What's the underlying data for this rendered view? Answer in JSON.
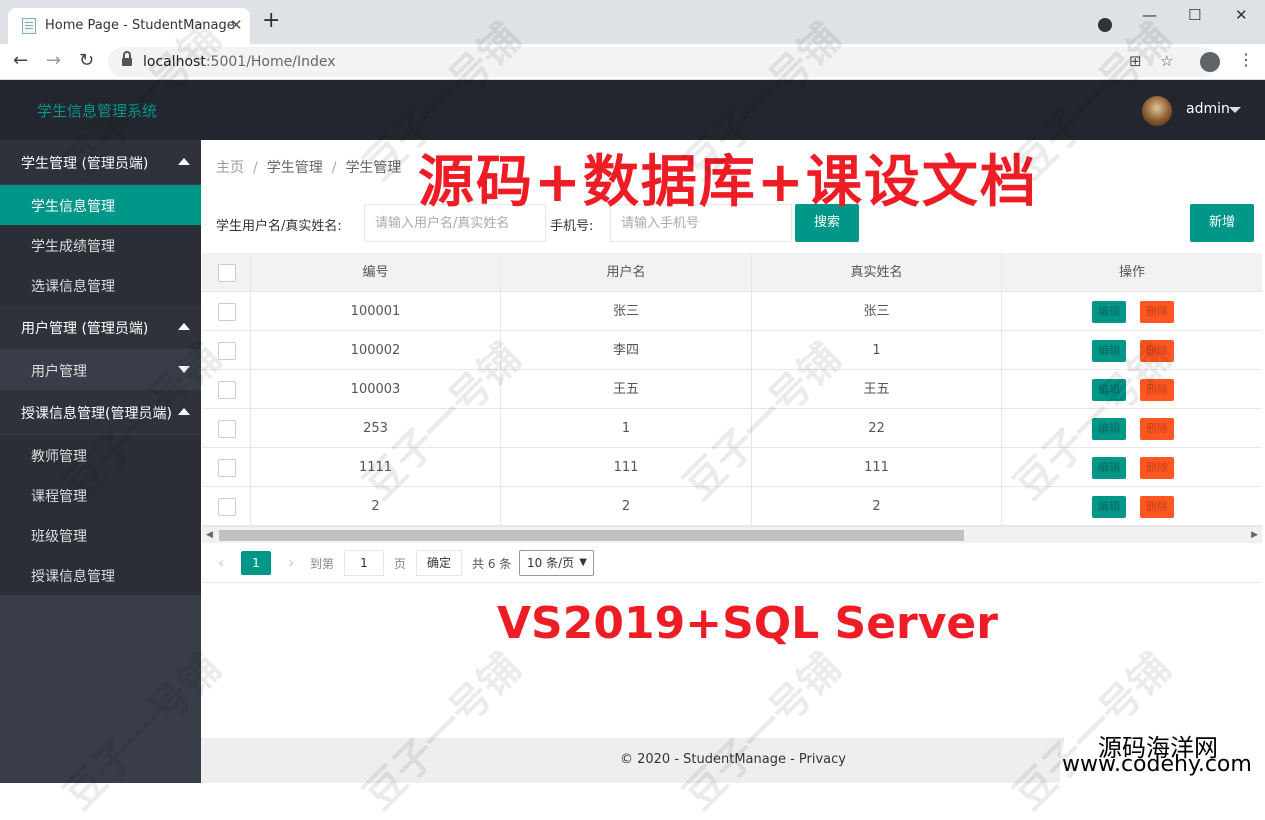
{
  "browser": {
    "tab_title": "Home Page - StudentManage",
    "tab_close": "✕",
    "new_tab": "+",
    "url_host": "localhost",
    "url_path": ":5001/Home/Index",
    "back": "←",
    "forward": "→",
    "reload": "↻",
    "minimize": "—",
    "maximize": "☐",
    "close": "✕"
  },
  "header": {
    "logo": "学生信息管理系统",
    "username": "admin"
  },
  "sidebar": {
    "groups": [
      {
        "label": "学生管理 (管理员端)"
      },
      {
        "label": "用户管理 (管理员端)"
      },
      {
        "label": "授课信息管理(管理员端)"
      }
    ],
    "items": [
      {
        "label": "学生信息管理"
      },
      {
        "label": "学生成绩管理"
      },
      {
        "label": "选课信息管理"
      },
      {
        "label": "用户管理"
      },
      {
        "label": "教师管理"
      },
      {
        "label": "课程管理"
      },
      {
        "label": "班级管理"
      },
      {
        "label": "授课信息管理"
      }
    ]
  },
  "breadcrumb": {
    "home": "主页",
    "level1": "学生管理",
    "level2": "学生管理",
    "sep": "/"
  },
  "search": {
    "name_label": "学生用户名/真实姓名:",
    "name_placeholder": "请输入用户名/真实姓名",
    "phone_label": "手机号:",
    "phone_placeholder": "请输入手机号",
    "search_button": "搜索",
    "add_button": "新增"
  },
  "table": {
    "columns": [
      "编号",
      "用户名",
      "真实姓名",
      "操作"
    ],
    "rows": [
      {
        "id": "100001",
        "username": "张三",
        "realname": "张三"
      },
      {
        "id": "100002",
        "username": "李四",
        "realname": "1"
      },
      {
        "id": "100003",
        "username": "王五",
        "realname": "王五"
      },
      {
        "id": "253",
        "username": "1",
        "realname": "22"
      },
      {
        "id": "1111",
        "username": "111",
        "realname": "111"
      },
      {
        "id": "2",
        "username": "2",
        "realname": "2"
      }
    ],
    "edit_label": "编辑",
    "delete_label": "删除"
  },
  "pager": {
    "current": "1",
    "goto_prefix": "到第",
    "goto_value": "1",
    "page_suffix": "页",
    "confirm": "确定",
    "total": "共 6 条",
    "page_size": "10 条/页"
  },
  "overlay": {
    "top": "源码+数据库+课设文档",
    "middle": "VS2019+SQL Server"
  },
  "footer": {
    "text": "© 2020 - StudentManage - Privacy"
  },
  "branding": {
    "cn": "源码海洋网",
    "url": "www.codehy.com"
  },
  "watermark": "豆子一号铺",
  "colors": {
    "primary": "#009688",
    "danger": "#ff5722",
    "header": "#23262e",
    "sidebar": "#393d49",
    "overlay_red": "#ee1c25"
  }
}
